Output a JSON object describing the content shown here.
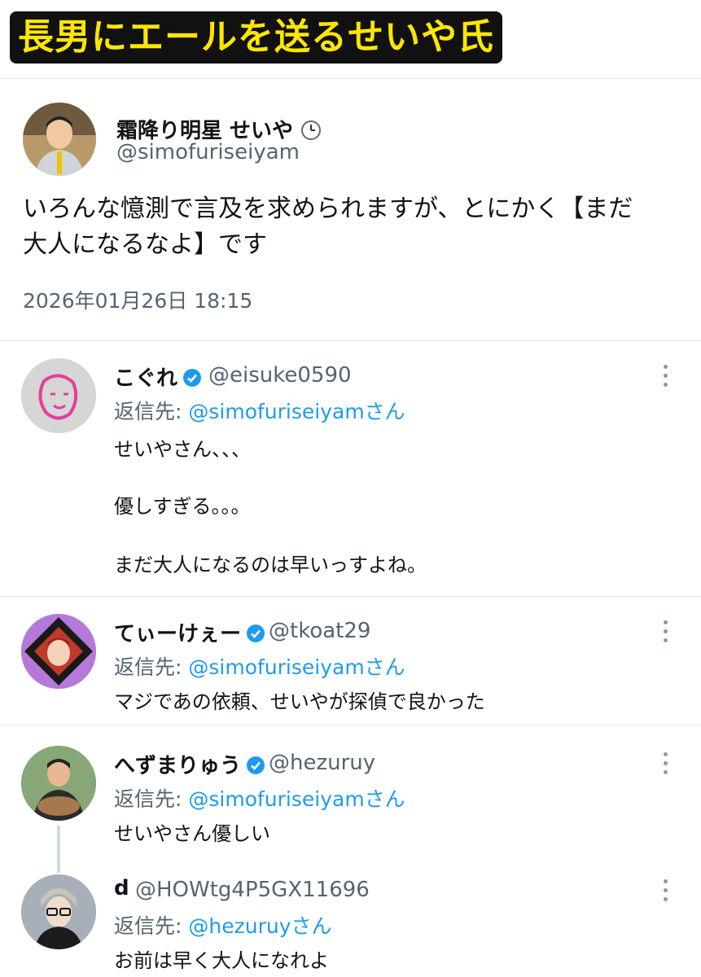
{
  "banner": {
    "title": "長男にエールを送るせいや氏"
  },
  "main_post": {
    "author_name": "霜降り明星 せいや",
    "clock_icon": "clock-icon",
    "handle": "@simofuriseiyam",
    "text_line1": "いろんな憶測で言及を求められますが、とにかく【まだ",
    "text_line2": "大人になるなよ】です",
    "timestamp": "2026年01月26日 18:15"
  },
  "replies": [
    {
      "name": "こぐれ",
      "handle": "@eisuke0590",
      "reply_label": "返信先: ",
      "reply_mention": "@simofuriseiyamさん",
      "lines": [
        "せいやさん、、、",
        "優しすぎる。。。",
        "まだ大人になるのは早いっすよね。"
      ]
    },
    {
      "name": "てぃーけぇー",
      "handle": "@tkoat29",
      "reply_label": "返信先: ",
      "reply_mention": "@simofuriseiyamさん",
      "lines": [
        "マジであの依頼、せいやが探偵で良かった"
      ]
    },
    {
      "name": "へずまりゅう",
      "handle": "@hezuruy",
      "reply_label": "返信先: ",
      "reply_mention": "@simofuriseiyamさん",
      "lines": [
        "せいやさん優しい"
      ]
    },
    {
      "name": "d",
      "handle": "@HOWtg4P5GX11696",
      "reply_label": "返信先: ",
      "reply_mention": "@hezuruyさん",
      "lines": [
        "お前は早く大人になれよ"
      ]
    }
  ],
  "colors": {
    "accent": "#1d9bf0",
    "banner_text": "#ffe600",
    "muted": "#536471"
  }
}
